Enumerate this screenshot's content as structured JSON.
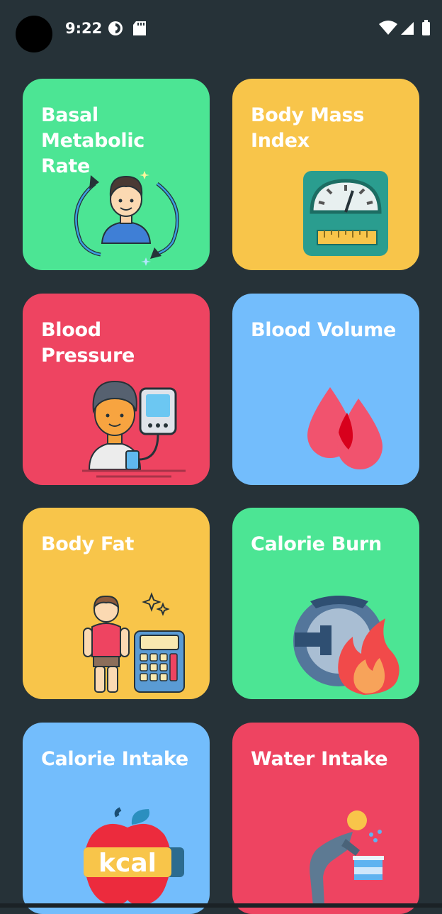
{
  "status_bar": {
    "time": "9:22",
    "icons_left": [
      "data-saver-icon",
      "sd-card-icon"
    ],
    "icons_right": [
      "wifi-icon",
      "cell-signal-icon",
      "battery-icon"
    ]
  },
  "cards": [
    {
      "title_lines": [
        "Basal",
        "Metabolic Rate"
      ],
      "color": "#4ce594",
      "icon": "metabolism-person-icon"
    },
    {
      "title_lines": [
        "Body Mass",
        "Index"
      ],
      "color": "#f8c54a",
      "icon": "weighing-scale-icon"
    },
    {
      "title_lines": [
        "Blood Pressure"
      ],
      "color": "#ee4461",
      "icon": "blood-pressure-monitor-icon"
    },
    {
      "title_lines": [
        "Blood Volume"
      ],
      "color": "#73bdfc",
      "icon": "blood-drops-icon"
    },
    {
      "title_lines": [
        "Body Fat"
      ],
      "color": "#f8c54a",
      "icon": "body-fat-calculator-icon"
    },
    {
      "title_lines": [
        "Calorie Burn"
      ],
      "color": "#4ce594",
      "icon": "plate-fire-icon"
    },
    {
      "title_lines": [
        "Calorie Intake"
      ],
      "color": "#73bdfc",
      "icon": "apple-kcal-icon",
      "icon_text": "kcal"
    },
    {
      "title_lines": [
        "Water Intake"
      ],
      "color": "#ee4461",
      "icon": "drinking-fountain-icon"
    }
  ]
}
